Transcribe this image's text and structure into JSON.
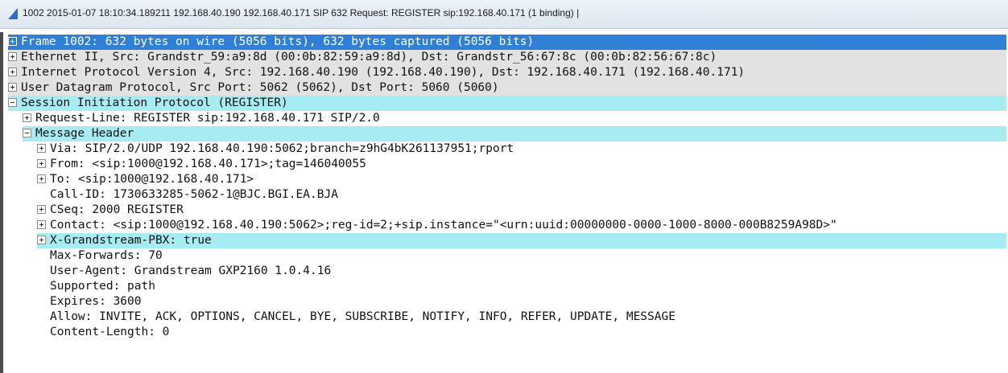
{
  "titlebar": {
    "text": "1002 2015-01-07 18:10:34.189211 192.168.40.190 192.168.40.171 SIP 632 Request: REGISTER sip:192.168.40.171  (1 binding) |",
    "icon": "shark-fin-icon"
  },
  "tree": [
    {
      "text": "Frame 1002: 632 bytes on wire (5056 bits), 632 bytes captured (5056 bits)",
      "expander": "plus"
    },
    {
      "text": "Ethernet II, Src: Grandstr_59:a9:8d (00:0b:82:59:a9:8d), Dst: Grandstr_56:67:8c (00:0b:82:56:67:8c)",
      "expander": "plus"
    },
    {
      "text": "Internet Protocol Version 4, Src: 192.168.40.190 (192.168.40.190), Dst: 192.168.40.171 (192.168.40.171)",
      "expander": "plus"
    },
    {
      "text": "User Datagram Protocol, Src Port: 5062 (5062), Dst Port: 5060 (5060)",
      "expander": "plus"
    },
    {
      "text": "Session Initiation Protocol (REGISTER)",
      "expander": "minus"
    },
    {
      "text": "Request-Line: REGISTER sip:192.168.40.171 SIP/2.0",
      "expander": "plus"
    },
    {
      "text": "Message Header",
      "expander": "minus"
    },
    {
      "text": "Via: SIP/2.0/UDP 192.168.40.190:5062;branch=z9hG4bK261137951;rport",
      "expander": "plus"
    },
    {
      "text": "From: <sip:1000@192.168.40.171>;tag=146040055",
      "expander": "plus"
    },
    {
      "text": "To: <sip:1000@192.168.40.171>",
      "expander": "plus"
    },
    {
      "text": "Call-ID: 1730633285-5062-1@BJC.BGI.EA.BJA",
      "expander": "none"
    },
    {
      "text": "CSeq: 2000 REGISTER",
      "expander": "plus"
    },
    {
      "text": "Contact: <sip:1000@192.168.40.190:5062>;reg-id=2;+sip.instance=\"<urn:uuid:00000000-0000-1000-8000-000B8259A98D>\"",
      "expander": "plus"
    },
    {
      "text": "X-Grandstream-PBX: true",
      "expander": "plus"
    },
    {
      "text": "Max-Forwards: 70",
      "expander": "none"
    },
    {
      "text": "User-Agent: Grandstream GXP2160 1.0.4.16",
      "expander": "none"
    },
    {
      "text": "Supported: path",
      "expander": "none"
    },
    {
      "text": "Expires: 3600",
      "expander": "none"
    },
    {
      "text": "Allow: INVITE, ACK, OPTIONS, CANCEL, BYE, SUBSCRIBE, NOTIFY, INFO, REFER, UPDATE, MESSAGE",
      "expander": "none"
    },
    {
      "text": "Content-Length: 0",
      "expander": "none"
    }
  ],
  "colors": {
    "selected": "#2f7fd6",
    "highlight": "#a6ecf2",
    "protocol_row": "#e2e2e2"
  }
}
